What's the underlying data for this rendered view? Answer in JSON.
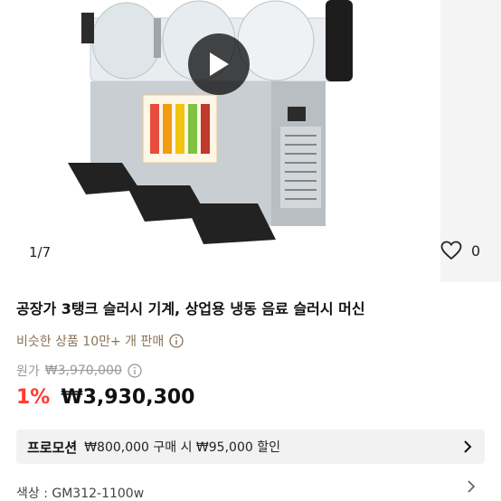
{
  "gallery": {
    "counter": "1/7",
    "like_count": "0",
    "play_icon": "play-icon",
    "heart_icon": "heart-outline-icon"
  },
  "product": {
    "title": "공장가 3탱크 슬러시 기계, 상업용 냉동 음료 슬러시 머신",
    "similar_sold": "비슷한 상품 10만+ 개 판매",
    "original_label": "원가",
    "original_price": "₩3,970,000",
    "discount": "1%",
    "price": "₩3,930,300"
  },
  "promotion": {
    "badge": "프로모션",
    "text": "₩800,000 구매 시 ₩95,000 할인"
  },
  "option": {
    "text": "색상 : GM312-1100w"
  },
  "colors": {
    "discount": "#ff3b30",
    "sold_text": "#8a7258",
    "promo_bg": "#f2f2f2"
  }
}
